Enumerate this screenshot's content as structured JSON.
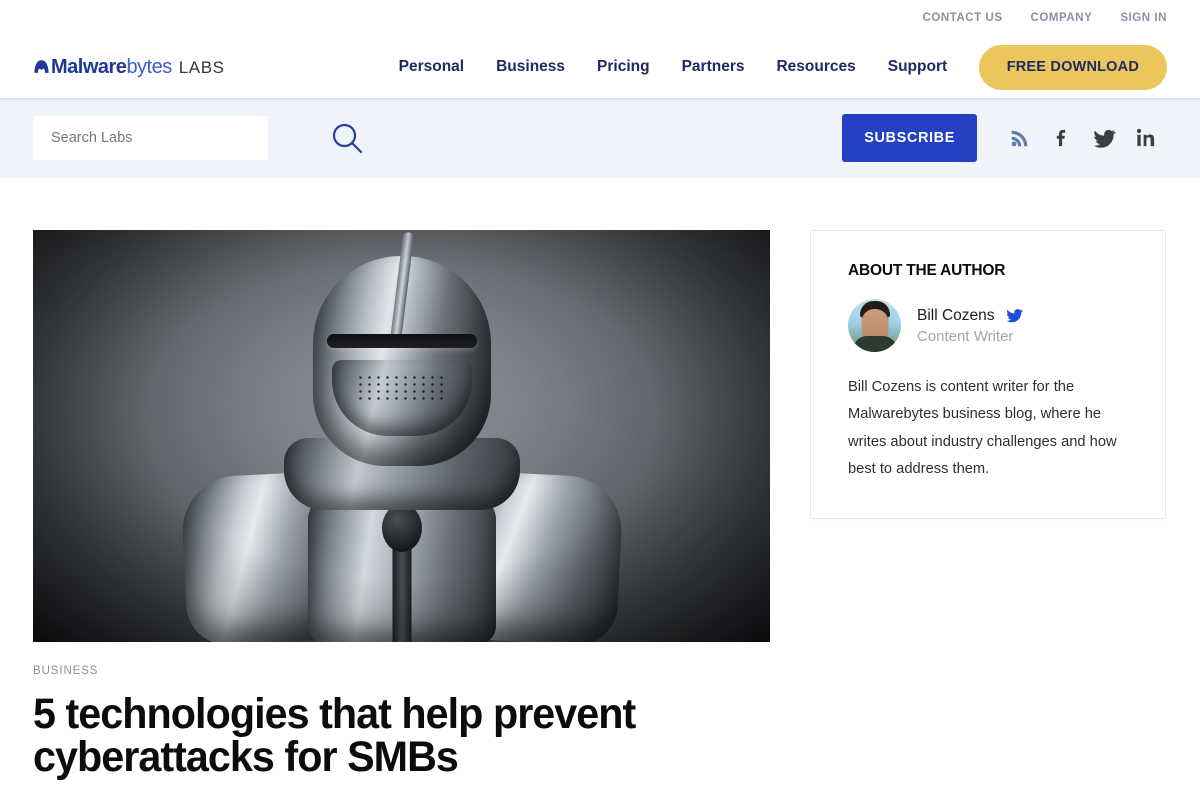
{
  "utility_nav": {
    "items": [
      {
        "label": "CONTACT US",
        "name": "contact-us"
      },
      {
        "label": "COMPANY",
        "name": "company"
      },
      {
        "label": "SIGN IN",
        "name": "sign-in"
      }
    ]
  },
  "brand": {
    "malware": "Malware",
    "bytes": "bytes",
    "labs": "LABS"
  },
  "main_nav": {
    "items": [
      {
        "label": "Personal"
      },
      {
        "label": "Business"
      },
      {
        "label": "Pricing"
      },
      {
        "label": "Partners"
      },
      {
        "label": "Resources"
      },
      {
        "label": "Support"
      }
    ]
  },
  "header": {
    "cta_label": "FREE DOWNLOAD"
  },
  "search": {
    "placeholder": "Search Labs",
    "value": "",
    "icon": "search-icon"
  },
  "subscribe": {
    "label": "SUBSCRIBE"
  },
  "social": {
    "items": [
      {
        "name": "rss-icon",
        "label": "RSS"
      },
      {
        "name": "facebook-icon",
        "label": "Facebook"
      },
      {
        "name": "twitter-icon",
        "label": "Twitter"
      },
      {
        "name": "linkedin-icon",
        "label": "LinkedIn"
      }
    ]
  },
  "article": {
    "category": "BUSINESS",
    "title": "5 technologies that help prevent cyberattacks for SMBs",
    "hero_alt": "Black and white photograph of a suit of medieval plate armor with closed helmet"
  },
  "sidebar": {
    "author_card": {
      "heading": "ABOUT THE AUTHOR",
      "name": "Bill Cozens",
      "role": "Content Writer",
      "twitter_icon": "twitter-icon",
      "bio": "Bill Cozens is content writer for the Malwarebytes business blog, where he writes about industry challenges and how best to address them."
    }
  },
  "colors": {
    "brand_navy": "#1e2a63",
    "brand_blue": "#2440c4",
    "cta_yellow": "#ebc65c",
    "search_band": "#eff3fc",
    "utility_text": "#8b90a8",
    "social_dark": "#3a3f47",
    "rss_blue": "#5d7ca8"
  }
}
